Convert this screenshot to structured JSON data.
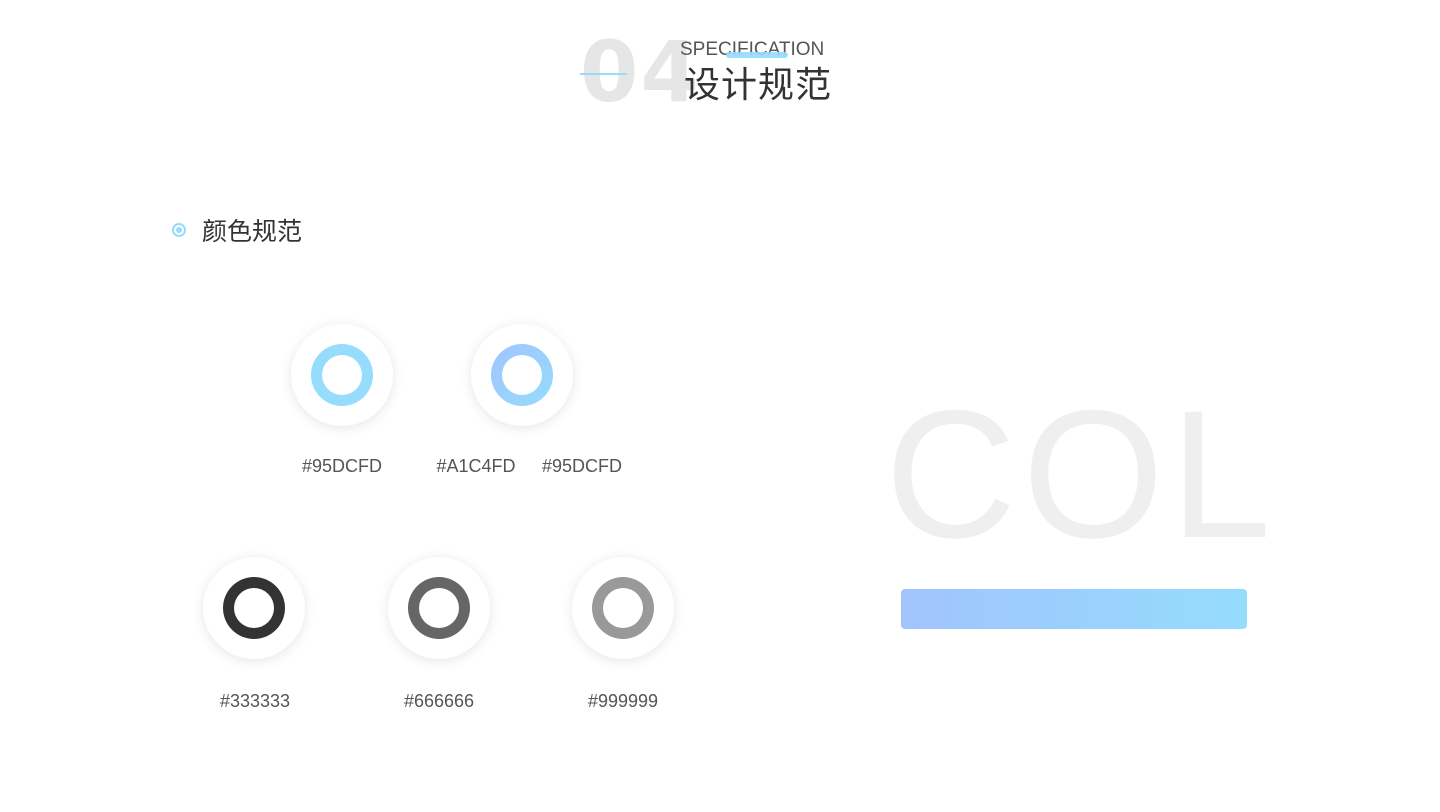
{
  "header": {
    "number": "04",
    "subtitle": "SPECIFICATION",
    "title": "设计规范"
  },
  "section": {
    "title": "颜色规范"
  },
  "colors": {
    "accent": "#95DCFD"
  },
  "swatches": [
    {
      "label": "#95DCFD",
      "colors": [
        "#95DCFD",
        "#95DCFD"
      ]
    },
    {
      "label": "#A1C4FD",
      "colors": [
        "#A1C4FD",
        "#95DCFD"
      ]
    },
    {
      "label": "#95DCFD"
    },
    {
      "label": "#333333",
      "colors": [
        "#333333",
        "#333333"
      ]
    },
    {
      "label": "#666666",
      "colors": [
        "#666666",
        "#666666"
      ]
    },
    {
      "label": "#999999",
      "colors": [
        "#999999",
        "#999999"
      ]
    }
  ],
  "watermark": "COL",
  "gradient": {
    "from": "#A1C4FD",
    "to": "#95DCFD"
  }
}
